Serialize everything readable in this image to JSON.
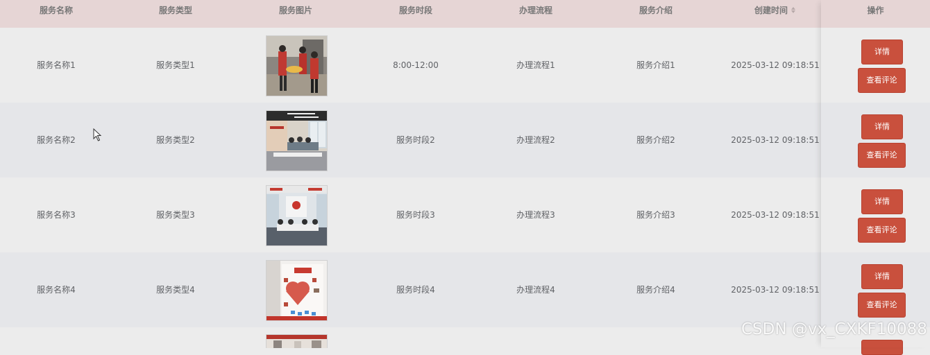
{
  "table": {
    "headers": {
      "name": "服务名称",
      "type": "服务类型",
      "image": "服务图片",
      "period": "服务时段",
      "process": "办理流程",
      "intro": "服务介绍",
      "created": "创建时间",
      "actions": "操作"
    },
    "rows": [
      {
        "name": "服务名称1",
        "type": "服务类型1",
        "period": "8:00-12:00",
        "process": "办理流程1",
        "intro": "服务介绍1",
        "created": "2025-03-12 09:18:51",
        "detail_label": "详情",
        "review_label": "查看评论"
      },
      {
        "name": "服务名称2",
        "type": "服务类型2",
        "period": "服务时段2",
        "process": "办理流程2",
        "intro": "服务介绍2",
        "created": "2025-03-12 09:18:51",
        "detail_label": "详情",
        "review_label": "查看评论"
      },
      {
        "name": "服务名称3",
        "type": "服务类型3",
        "period": "服务时段3",
        "process": "办理流程3",
        "intro": "服务介绍3",
        "created": "2025-03-12 09:18:51",
        "detail_label": "详情",
        "review_label": "查看评论"
      },
      {
        "name": "服务名称4",
        "type": "服务类型4",
        "period": "服务时段4",
        "process": "办理流程4",
        "intro": "服务介绍4",
        "created": "2025-03-12 09:18:51",
        "detail_label": "详情",
        "review_label": "查看评论"
      }
    ]
  },
  "colors": {
    "header_bg": "#e6d5d5",
    "button_bg": "#c9503d",
    "row_alt_bg": "#e5e6e9"
  },
  "icons": {
    "sort": "sort-caret-icon",
    "cursor": "mouse-pointer-icon"
  },
  "watermark": "CSDN @vx_CXKF10088"
}
